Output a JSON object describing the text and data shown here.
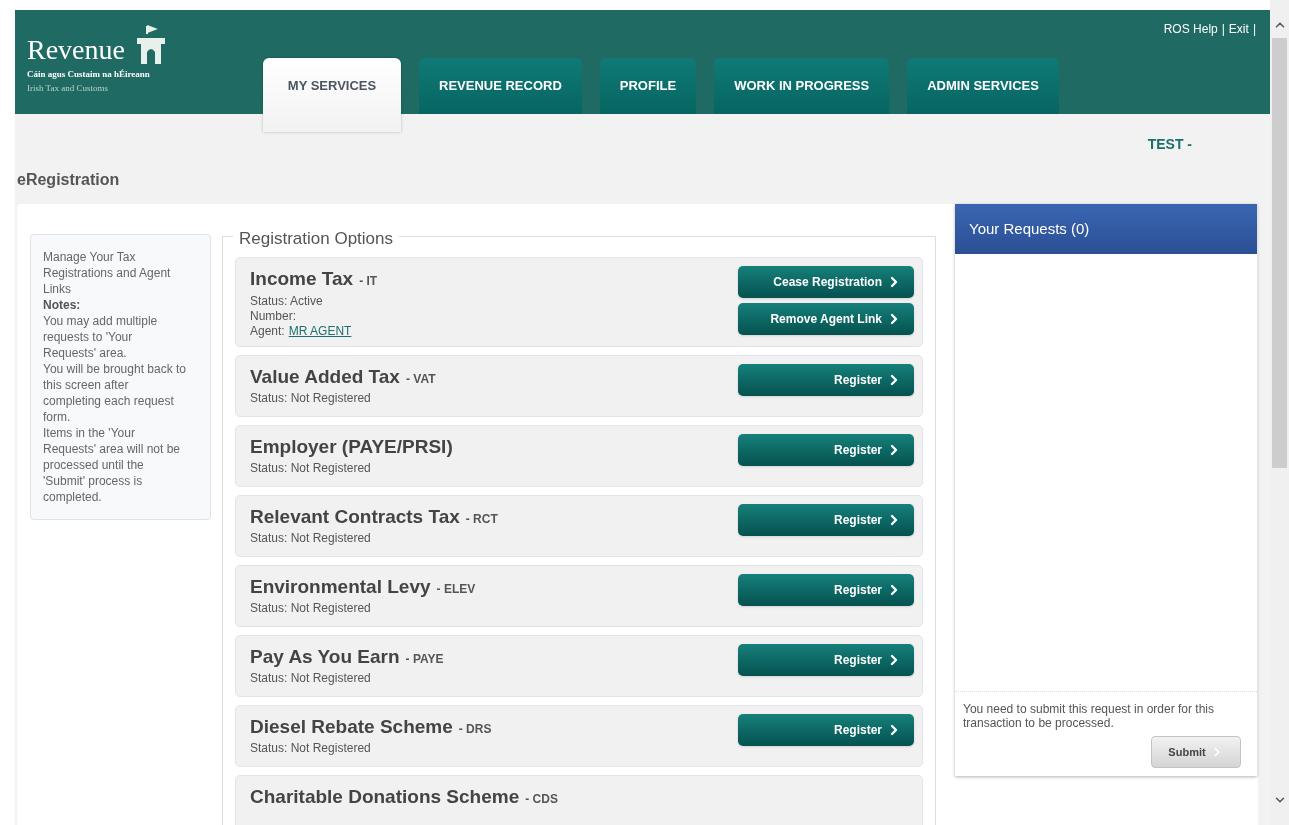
{
  "header": {
    "logo": {
      "name": "Revenue",
      "subtitle_irish": "Cáin agus Custaim na hÉireann",
      "subtitle_english": "Irish Tax and Customs"
    },
    "tabs": [
      {
        "label": "MY SERVICES",
        "selected": true
      },
      {
        "label": "REVENUE RECORD",
        "selected": false
      },
      {
        "label": "PROFILE",
        "selected": false
      },
      {
        "label": "WORK IN PROGRESS",
        "selected": false
      },
      {
        "label": "ADMIN SERVICES",
        "selected": false
      }
    ],
    "links": [
      "ROS Help",
      "Exit"
    ],
    "separator": "|"
  },
  "user": "TEST -",
  "page_title": "eRegistration",
  "notes": {
    "intro": "Manage Your Tax Registrations and Agent Links",
    "heading": "Notes:",
    "lines": [
      "You may add multiple requests to 'Your Requests' area.",
      "You will be brought back to this screen after completing each request form.",
      "Items in the 'Your Requests' area will not be processed until the 'Submit' process is completed."
    ]
  },
  "registration_options": {
    "legend": "Registration Options",
    "items": [
      {
        "name": "Income Tax",
        "code": "- IT",
        "status": "Status: Active",
        "number_label": "Number:",
        "agent_label": "Agent:",
        "agent_link": "MR AGENT",
        "buttons": [
          "Cease Registration",
          "Remove Agent Link"
        ]
      },
      {
        "name": "Value Added Tax",
        "code": "- VAT",
        "status": "Status: Not Registered",
        "buttons": [
          "Register"
        ]
      },
      {
        "name": "Employer (PAYE/PRSI)",
        "status": "Status: Not Registered",
        "buttons": [
          "Register"
        ]
      },
      {
        "name": "Relevant Contracts Tax",
        "code": "- RCT",
        "status": "Status: Not Registered",
        "buttons": [
          "Register"
        ]
      },
      {
        "name": "Environmental Levy",
        "code": "- ELEV",
        "status": "Status: Not Registered",
        "buttons": [
          "Register"
        ]
      },
      {
        "name": "Pay As You Earn",
        "code": "- PAYE",
        "status": "Status: Not Registered",
        "buttons": [
          "Register"
        ]
      },
      {
        "name": "Diesel Rebate Scheme",
        "code": "- DRS",
        "status": "Status: Not Registered",
        "buttons": [
          "Register"
        ]
      },
      {
        "name": "Charitable Donations Scheme",
        "code": "- CDS"
      }
    ]
  },
  "requests": {
    "title": "Your Requests (0)",
    "message": "You need to submit this request in order for this transaction to be processed.",
    "submit": "Submit"
  }
}
